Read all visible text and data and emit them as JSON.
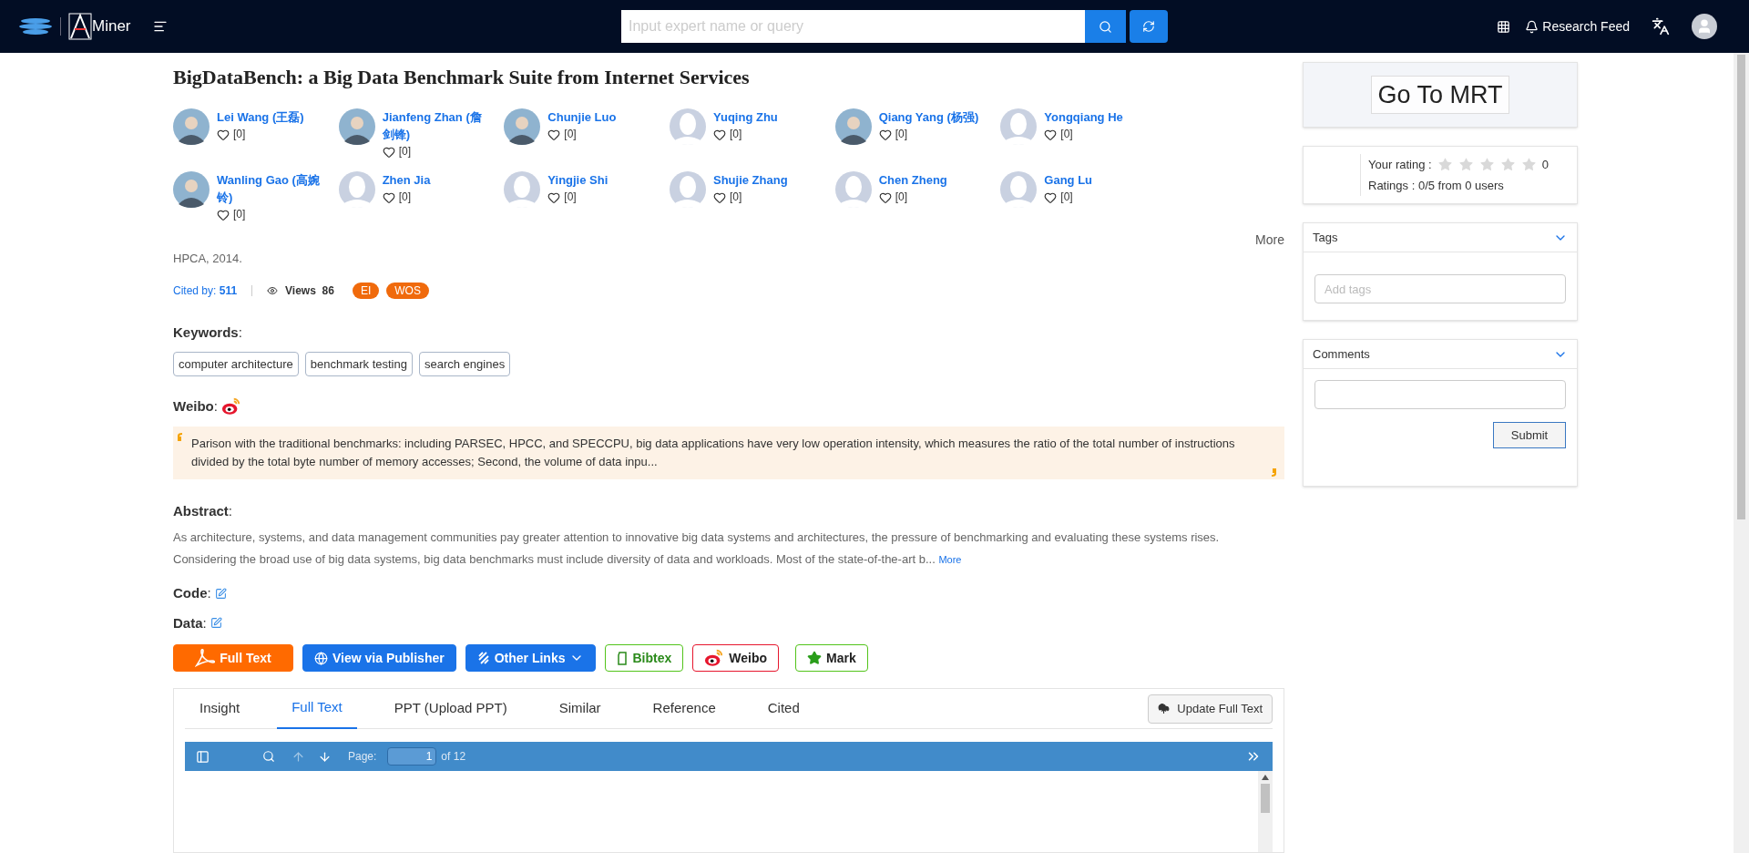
{
  "header": {
    "logo_text": "Miner",
    "search": {
      "placeholder": "Input expert name or query"
    },
    "research_feed": "Research Feed"
  },
  "paper": {
    "title": "BigDataBench: a Big Data Benchmark Suite from Internet Services",
    "authors": [
      {
        "name": "Lei Wang (王磊)",
        "likes": "[0]",
        "kind": "photo"
      },
      {
        "name": "Jianfeng Zhan (詹剑锋)",
        "likes": "[0]",
        "kind": "photo"
      },
      {
        "name": "Chunjie Luo",
        "likes": "[0]",
        "kind": "photo"
      },
      {
        "name": "Yuqing Zhu",
        "likes": "[0]",
        "kind": "placeholder"
      },
      {
        "name": "Qiang Yang (杨强)",
        "likes": "[0]",
        "kind": "photo"
      },
      {
        "name": "Yongqiang He",
        "likes": "[0]",
        "kind": "placeholder"
      },
      {
        "name": "Wanling Gao (高婉铃)",
        "likes": "[0]",
        "kind": "photo"
      },
      {
        "name": "Zhen Jia",
        "likes": "[0]",
        "kind": "placeholder"
      },
      {
        "name": "Yingjie Shi",
        "likes": "[0]",
        "kind": "placeholder"
      },
      {
        "name": "Shujie Zhang",
        "likes": "[0]",
        "kind": "placeholder"
      },
      {
        "name": "Chen Zheng",
        "likes": "[0]",
        "kind": "placeholder"
      },
      {
        "name": "Gang Lu",
        "likes": "[0]",
        "kind": "placeholder"
      }
    ],
    "more": "More",
    "venue": "HPCA, 2014.",
    "cited_label": "Cited by:",
    "cited_count": "511",
    "views_label": "Views",
    "views_count": "86",
    "badges": [
      "EI",
      "WOS"
    ],
    "keywords_label": "**Keywords**:",
    "keywords": [
      "computer architecture",
      "benchmark testing",
      "search engines"
    ],
    "weibo_label": "**Weibo**:",
    "weibo_quote": "Parison with the traditional benchmarks: including PARSEC, HPCC, and SPECCPU, big data applications have very low operation intensity, which measures the ratio of the total number of instructions divided by the total byte number of memory accesses; Second, the volume of data inpu...",
    "abstract_label": "**Abstract**:",
    "abstract": "As architecture, systems, and data management communities pay greater attention to innovative big data systems and architectures, the pressure of benchmarking and evaluating these systems rises. Considering the broad use of big data systems, big data benchmarks must include diversity of data and workloads. Most of the state-of-the-art b...",
    "abstract_more": "More",
    "code_label": "**Code**:",
    "data_label": "**Data**:",
    "actions": [
      {
        "label": "Full Text",
        "kind": "pdf"
      },
      {
        "label": "View via Publisher",
        "kind": "publisher"
      },
      {
        "label": "Other Links",
        "kind": "links"
      },
      {
        "label": "Bibtex",
        "kind": "bibtex"
      },
      {
        "label": "Weibo",
        "kind": "weibo"
      },
      {
        "label": "Mark",
        "kind": "mark"
      }
    ],
    "tabs": [
      {
        "label": "Insight",
        "selected": false
      },
      {
        "label": "Full Text",
        "selected": true
      },
      {
        "label": "PPT (Upload PPT)",
        "selected": false
      },
      {
        "label": "Similar",
        "selected": false
      },
      {
        "label": "Reference",
        "selected": false
      },
      {
        "label": "Cited",
        "selected": false
      }
    ],
    "update_button": "Update Full Text",
    "viewer": {
      "page_label": "Page:",
      "page": "1",
      "page_total": "of 12"
    }
  },
  "sidebar": {
    "mrt": "Go To MRT",
    "rating_label": "Your rating :",
    "stars": 0,
    "rating_value": "0",
    "ratings_summary": "Ratings : 0/5 from 0 users",
    "tags_title": "Tags",
    "tags_placeholder": "Add tags",
    "comments_title": "Comments",
    "submit": "Submit"
  }
}
